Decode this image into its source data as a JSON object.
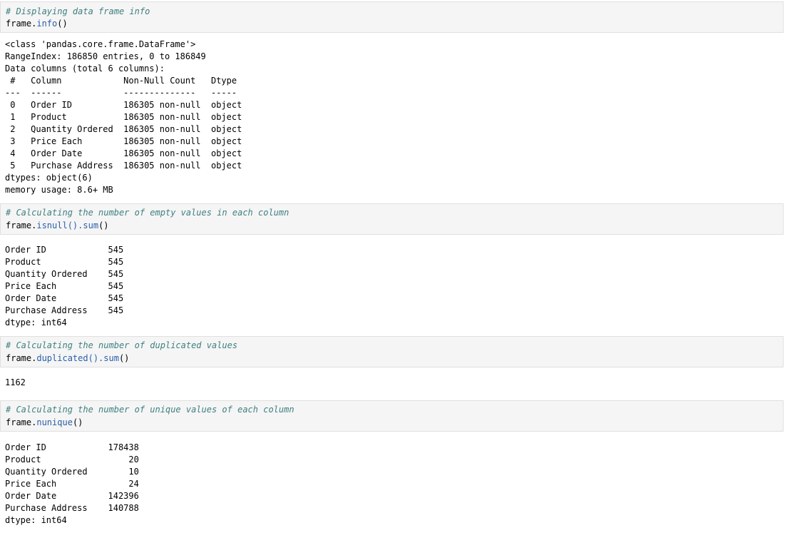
{
  "cells": [
    {
      "comment": "# Displaying data frame info",
      "code_object": "frame.",
      "code_method": "info",
      "code_args": "()",
      "output": [
        "<class 'pandas.core.frame.DataFrame'>",
        "RangeIndex: 186850 entries, 0 to 186849",
        "Data columns (total 6 columns):",
        " #   Column            Non-Null Count   Dtype ",
        "---  ------            --------------   ----- ",
        " 0   Order ID          186305 non-null  object",
        " 1   Product           186305 non-null  object",
        " 2   Quantity Ordered  186305 non-null  object",
        " 3   Price Each        186305 non-null  object",
        " 4   Order Date        186305 non-null  object",
        " 5   Purchase Address  186305 non-null  object",
        "dtypes: object(6)",
        "memory usage: 8.6+ MB"
      ]
    },
    {
      "comment": "# Calculating the number of empty values in each column",
      "code_object": "frame.",
      "code_method": "isnull().sum",
      "code_args": "()",
      "output": [
        "Order ID            545",
        "Product             545",
        "Quantity Ordered    545",
        "Price Each          545",
        "Order Date          545",
        "Purchase Address    545",
        "dtype: int64"
      ]
    },
    {
      "comment": "# Calculating the number of duplicated values",
      "code_object": "frame.",
      "code_method": "duplicated().sum",
      "code_args": "()",
      "output": [
        "1162"
      ]
    },
    {
      "comment": "# Calculating the number of unique values of each column",
      "code_object": "frame.",
      "code_method": "nunique",
      "code_args": "()",
      "output": [
        "Order ID            178438",
        "Product                 20",
        "Quantity Ordered        10",
        "Price Each              24",
        "Order Date          142396",
        "Purchase Address    140788",
        "dtype: int64"
      ]
    }
  ],
  "colors": {
    "cell_background": "#f5f5f5",
    "cell_border": "#e0e0e0",
    "comment": "#408080",
    "method": "#2a5ea8"
  }
}
